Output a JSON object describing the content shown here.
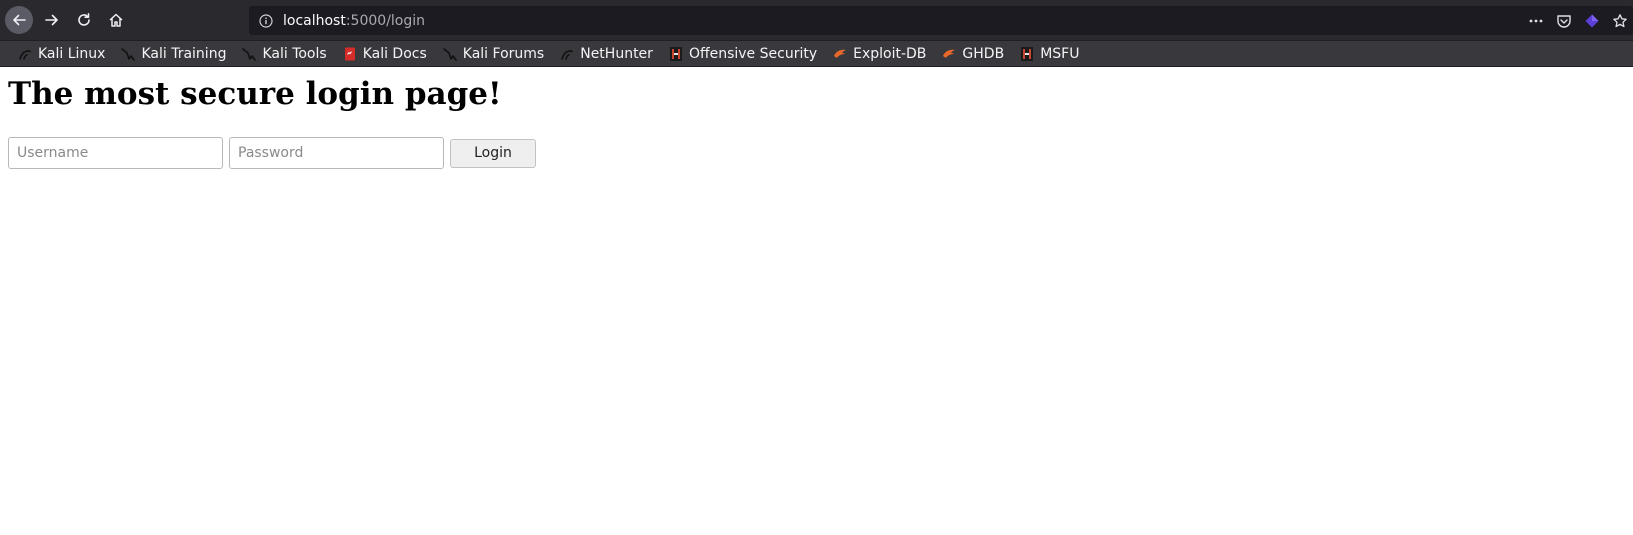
{
  "browser": {
    "url": {
      "host": "localhost",
      "path": ":5000/login"
    },
    "bookmarks": [
      {
        "label": "Kali Linux",
        "icon": "kali-dragon-icon"
      },
      {
        "label": "Kali Training",
        "icon": "kali-dragon-icon"
      },
      {
        "label": "Kali Tools",
        "icon": "kali-dragon-icon"
      },
      {
        "label": "Kali Docs",
        "icon": "kali-docs-icon"
      },
      {
        "label": "Kali Forums",
        "icon": "kali-dragon-icon"
      },
      {
        "label": "NetHunter",
        "icon": "kali-dragon-icon"
      },
      {
        "label": "Offensive Security",
        "icon": "offsec-icon"
      },
      {
        "label": "Exploit-DB",
        "icon": "exploit-db-icon"
      },
      {
        "label": "GHDB",
        "icon": "exploit-db-icon"
      },
      {
        "label": "MSFU",
        "icon": "offsec-icon"
      }
    ],
    "colors": {
      "toolbar": "#2a2a2e",
      "bookmarks_bar": "#38383d",
      "urlbar": "#1c1b22"
    }
  },
  "page": {
    "title": "The most secure login page!",
    "form": {
      "username_placeholder": "Username",
      "username_value": "",
      "password_placeholder": "Password",
      "password_value": "",
      "login_label": "Login"
    }
  }
}
